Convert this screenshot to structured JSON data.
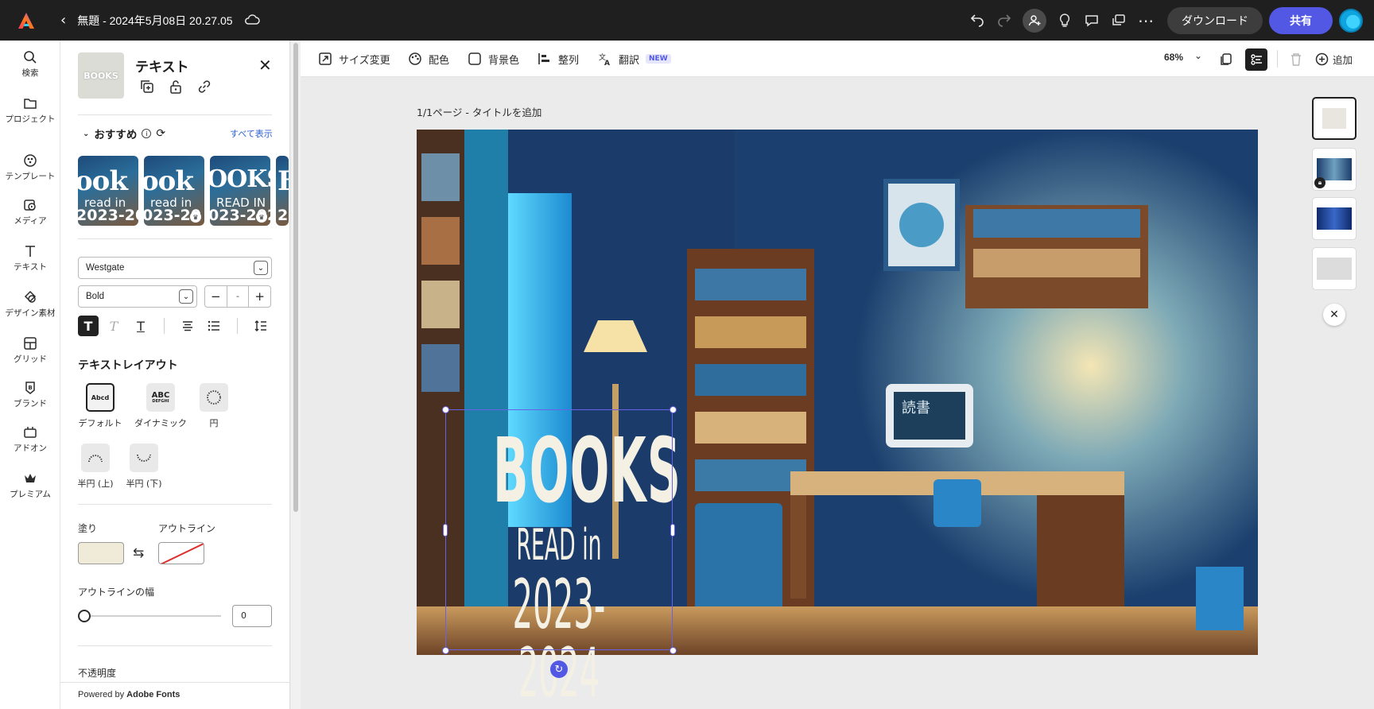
{
  "header": {
    "doc_title": "無題 - 2024年5月08日 20.27.05",
    "download_label": "ダウンロード",
    "share_label": "共有"
  },
  "rail": {
    "items": [
      {
        "label": "検索",
        "icon": "search-icon"
      },
      {
        "label": "プロジェクト",
        "icon": "folder-icon"
      },
      {
        "label": "テンプレート",
        "icon": "template-icon"
      },
      {
        "label": "メディア",
        "icon": "media-icon"
      },
      {
        "label": "テキスト",
        "icon": "text-icon"
      },
      {
        "label": "デザイン素材",
        "icon": "shapes-icon"
      },
      {
        "label": "グリッド",
        "icon": "grid-icon"
      },
      {
        "label": "ブランド",
        "icon": "brand-icon"
      },
      {
        "label": "アドオン",
        "icon": "addon-icon"
      },
      {
        "label": "プレミアム",
        "icon": "crown-icon"
      }
    ]
  },
  "panel": {
    "title": "テキスト",
    "thumb_text": "BOOKS",
    "recommended": {
      "heading": "おすすめ",
      "see_all": "すべて表示",
      "cards": [
        {
          "big": "ook",
          "small": "read in",
          "year": "2023-202"
        },
        {
          "big": "ook",
          "small": "read in",
          "year": "023-20"
        },
        {
          "big": "OOKS",
          "small": "READ IN",
          "year": "023-202"
        },
        {
          "big": "B",
          "small": "",
          "year": "2"
        }
      ]
    },
    "font_family": "Westgate",
    "font_weight": "Bold",
    "size_value": "-",
    "text_layout": {
      "title": "テキストレイアウト",
      "options": [
        {
          "label": "デフォルト",
          "preview": "Abcd"
        },
        {
          "label": "ダイナミック",
          "preview": "ABC"
        },
        {
          "label": "円",
          "preview": ""
        },
        {
          "label": "半円 (上)",
          "preview": ""
        },
        {
          "label": "半円 (下)",
          "preview": ""
        }
      ],
      "dynamic_sub": "DEFGHI"
    },
    "fill_label": "塗り",
    "outline_label": "アウトライン",
    "fill_color": "#efebd8",
    "outline_width_label": "アウトラインの幅",
    "outline_width_value": "0",
    "opacity_label": "不透明度",
    "powered_by": "Powered by",
    "powered_brand": "Adobe Fonts"
  },
  "toolbar": {
    "resize": "サイズ変更",
    "color_scheme": "配色",
    "background": "背景色",
    "align": "整列",
    "translate": "翻訳",
    "new_badge": "NEW",
    "zoom": "68%",
    "add": "追加"
  },
  "canvas": {
    "page_label": "1/1ページ - タイトルを追加",
    "text_line1": "BOOKS",
    "text_line2": "READ in",
    "text_line3": "2023-2024",
    "screen_text": "読書"
  },
  "colors": {
    "accent": "#5258e4",
    "topbar": "#1f1f1f"
  }
}
